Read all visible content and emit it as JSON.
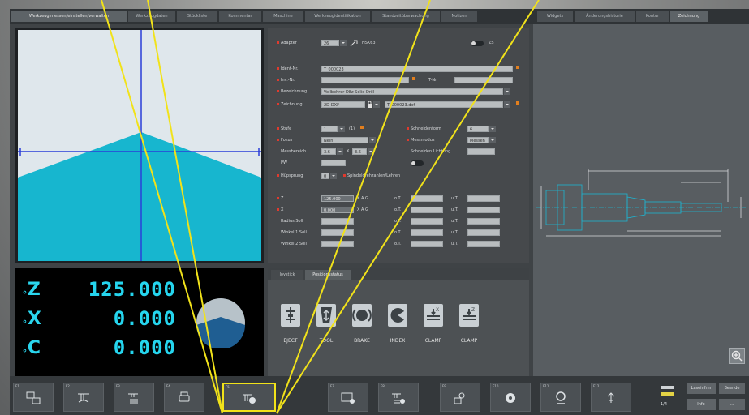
{
  "tabs": [
    {
      "label": "Werkzeug messen/einstellen/verwalten",
      "active": true
    },
    {
      "label": "Werkzeugdaten"
    },
    {
      "label": "Stückliste"
    },
    {
      "label": "Kommentar"
    },
    {
      "label": "Maschine"
    },
    {
      "label": "Werkzeugidentifikation"
    },
    {
      "label": "Standzeitüberwachung"
    },
    {
      "label": "Notizen"
    }
  ],
  "right_tabs": [
    {
      "label": "Widgets"
    },
    {
      "label": "Änderungshistorie"
    },
    {
      "label": "Kontur"
    },
    {
      "label": "Zeichnung",
      "active": true
    }
  ],
  "form": {
    "adapter_label": "Adapter",
    "adapter_value": "26",
    "adapter_code": "HSK63",
    "toggle_label": "ZS",
    "ident_label": "Ident-Nr.",
    "ident_value": "T_000023",
    "inv_label": "Inv.-Nr.",
    "tnr_label": "T-Nr.",
    "bezeichnung_label": "Bezeichnung",
    "bezeichnung_value": "Vollbohrer D8z Solid Drill",
    "zeichnung_label": "Zeichnung",
    "zeichnung_type": "2D-DXF",
    "zeichnung_file": "T_000023.dxf",
    "stufe_label": "Stufe",
    "stufe_value": "1",
    "stufe_of": "(1)",
    "schneidenform_label": "Schneidenform",
    "schneidenform_value": "6",
    "fokus_label": "Fokus",
    "fokus_value": "Nein",
    "messmodus_label": "Messmodus",
    "messmodus_value": "Messen",
    "messbereich_label": "Messbereich",
    "messbereich_a": "3.6",
    "messbereich_x": "X",
    "messbereich_b": "3.6",
    "schneiden_label": "Schneiden Lichtung",
    "pw_label": "PW",
    "winkel_label": "Hüpsprung",
    "winkel_value": "0",
    "spindel_label": "Spindeldrehzahlen/Lehren",
    "z_label": "Z",
    "z_value": "125.000",
    "x_label": "X",
    "x_value": "0.000",
    "radius_label": "Radius Soll",
    "winkel1_label": "Winkel 1 Soll",
    "winkel2_label": "Winkel 2 Soll",
    "xag": "X A G",
    "ot": "o.T.",
    "ut": "u.T."
  },
  "readout": {
    "z_axis": "Z",
    "z_value": "125.000",
    "x_axis": "X",
    "x_value": "0.000",
    "c_axis": "C",
    "c_value": "0.000"
  },
  "subpanel": {
    "tabs": [
      {
        "label": "Joystick"
      },
      {
        "label": "Positionsstatus",
        "active": true
      }
    ],
    "buttons": [
      {
        "label": "EJECT",
        "icon": "eject-icon"
      },
      {
        "label": "TOOL",
        "icon": "tool-icon"
      },
      {
        "label": "BRAKE",
        "icon": "brake-icon"
      },
      {
        "label": "INDEX",
        "icon": "index-icon"
      },
      {
        "label": "CLAMP",
        "icon": "clamp-x-icon",
        "axis": "X"
      },
      {
        "label": "CLAMP",
        "icon": "clamp-z-icon",
        "axis": "Z"
      }
    ]
  },
  "fkeys": [
    {
      "no": "F1",
      "icon": "tool-transfer-icon"
    },
    {
      "no": "F2",
      "icon": "tool-list-icon"
    },
    {
      "no": "F3",
      "icon": "tool-data-icon"
    },
    {
      "no": "F4",
      "icon": "print-icon"
    },
    {
      "no": "F5",
      "icon": "measure-tool-icon",
      "selected": true
    },
    {
      "no": "F7",
      "icon": "record-icon"
    },
    {
      "no": "F8",
      "icon": "tool-add-icon"
    },
    {
      "no": "F9",
      "icon": "search-icon"
    },
    {
      "no": "F10",
      "icon": "disc-icon"
    },
    {
      "no": "F11",
      "icon": "webcam-icon"
    },
    {
      "no": "F12",
      "icon": "settings-icon"
    }
  ],
  "page_indicator": "1/4",
  "right_buttons": [
    "Laseinfrm",
    "Beende",
    "Info",
    "..."
  ],
  "colors": {
    "accent_cyan": "#1fb4d0",
    "readout_cyan": "#25d5ee",
    "highlight_yellow": "#f1e21a",
    "crosshair_blue": "#2a3ed8"
  }
}
